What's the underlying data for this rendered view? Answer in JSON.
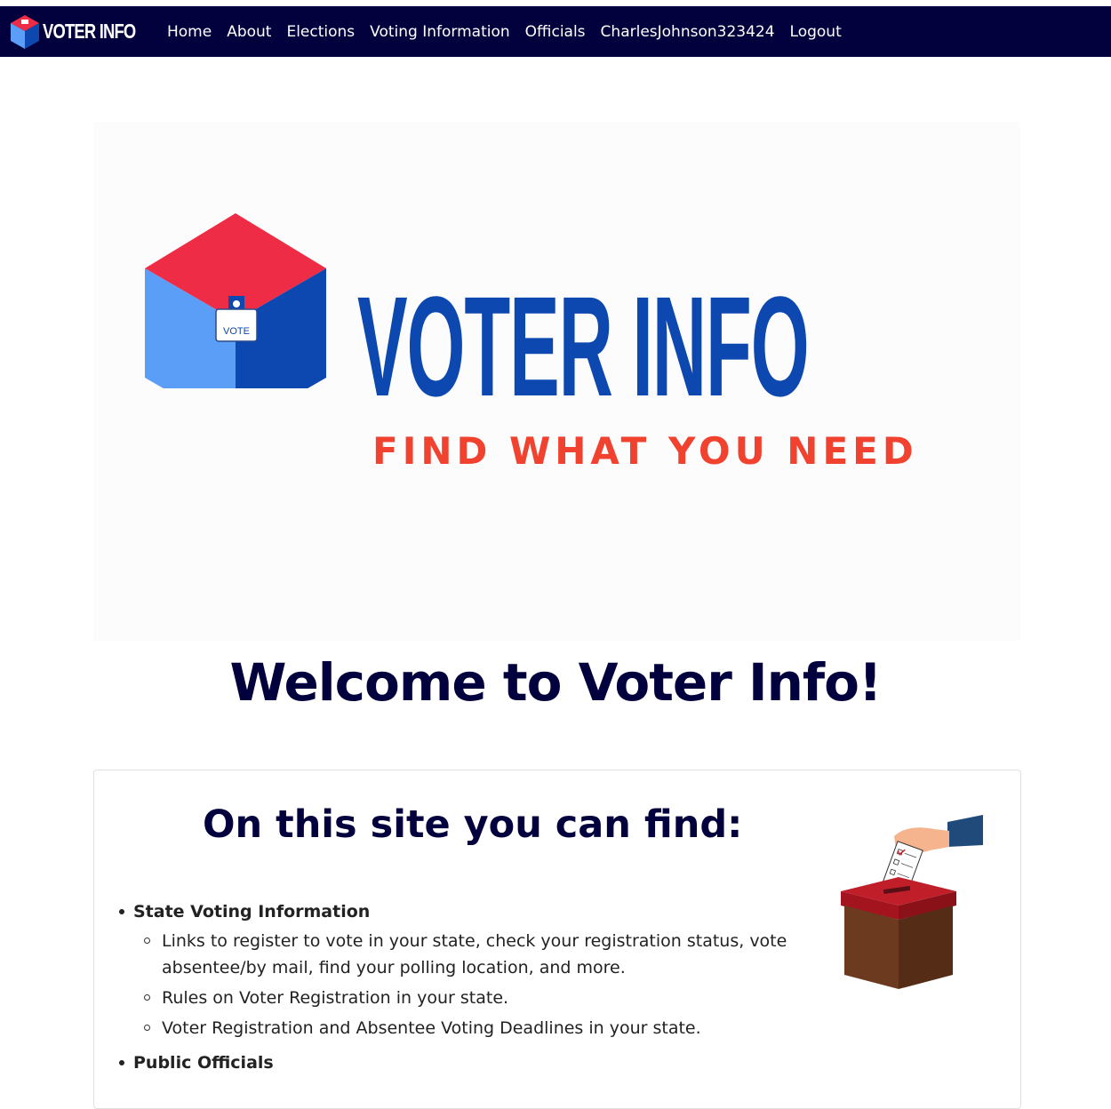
{
  "nav": {
    "brand": "VOTER INFO",
    "links": [
      "Home",
      "About",
      "Elections",
      "Voting Information",
      "Officials",
      "CharlesJohnson323424",
      "Logout"
    ]
  },
  "hero": {
    "title": "VOTER INFO",
    "tagline": "FIND WHAT YOU NEED",
    "box_label": "VOTE",
    "colors": {
      "blue": "#0d47b0",
      "red": "#f0422f",
      "cube_top": "#ee2c45",
      "cube_left": "#5a9ef8",
      "cube_right": "#0d47b0"
    }
  },
  "welcome": "Welcome to Voter Info!",
  "card": {
    "title": "On this site you can find:",
    "features": [
      {
        "heading": "State Voting Information",
        "items": [
          "Links to register to vote in your state, check your registration status, vote absentee/by mail, find your polling location, and more.",
          "Rules on Voter Registration in your state.",
          "Voter Registration and Absentee Voting Deadlines in your state."
        ]
      },
      {
        "heading": "Public Officials",
        "items": []
      }
    ]
  },
  "colors": {
    "navbar": "#02013d",
    "heading": "#02013d"
  }
}
